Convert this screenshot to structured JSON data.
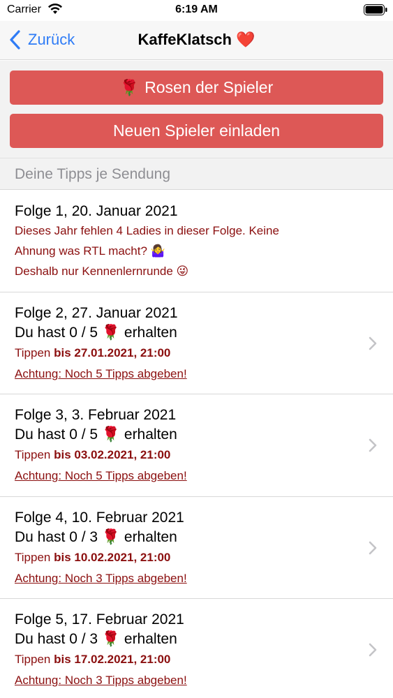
{
  "status_bar": {
    "carrier": "Carrier",
    "time": "6:19 AM"
  },
  "nav": {
    "back_label": "Zurück",
    "title": "KaffeKlatsch ❤️"
  },
  "buttons": {
    "roses_icon": "🌹",
    "roses_label": "Rosen der Spieler",
    "invite_label": "Neuen Spieler einladen"
  },
  "section": {
    "header": "Deine Tipps je Sendung"
  },
  "episodes": [
    {
      "title": "Folge 1, 20. Januar 2021",
      "notes": [
        "Dieses Jahr fehlen 4 Ladies in dieser Folge. Keine",
        "Ahnung was RTL macht? 🤷‍♀️",
        "Deshalb nur Kennenlernrunde 😜"
      ]
    },
    {
      "title": "Folge 2, 27. Januar 2021",
      "score": "Du hast 0 / 5 🌹 erhalten",
      "deadline_prefix": "Tippen",
      "deadline": "bis 27.01.2021, 21:00",
      "warning": "Achtung: Noch 5 Tipps abgeben!"
    },
    {
      "title": "Folge 3, 3. Februar 2021",
      "score": "Du hast 0 / 5 🌹 erhalten",
      "deadline_prefix": "Tippen",
      "deadline": "bis 03.02.2021, 21:00",
      "warning": "Achtung: Noch 5 Tipps abgeben!"
    },
    {
      "title": "Folge 4, 10. Februar 2021",
      "score": "Du hast 0 / 3 🌹 erhalten",
      "deadline_prefix": "Tippen",
      "deadline": "bis 10.02.2021, 21:00",
      "warning": "Achtung: Noch 3 Tipps abgeben!"
    },
    {
      "title": "Folge 5, 17. Februar 2021",
      "score": "Du hast 0 / 3 🌹 erhalten",
      "deadline_prefix": "Tippen",
      "deadline": "bis 17.02.2021, 21:00",
      "warning": "Achtung: Noch 3 Tipps abgeben!"
    }
  ],
  "colors": {
    "accent": "#2f7cf6",
    "button_red": "#dd5856",
    "note_red": "#8b0f0f"
  }
}
